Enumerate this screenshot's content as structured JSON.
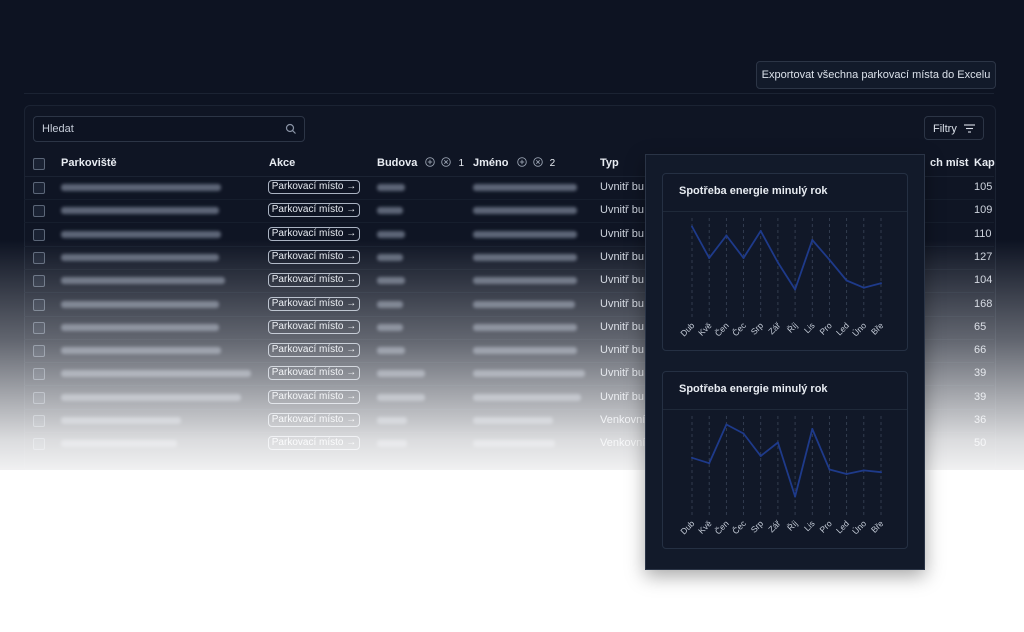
{
  "toolbar": {
    "export_label": "Exportovat všechna parkovací místa do Excelu"
  },
  "search": {
    "placeholder": "Hledat",
    "icon": "search-icon"
  },
  "filters": {
    "label": "Filtry",
    "icon": "filter-icon"
  },
  "table": {
    "columns": {
      "parkoviste": "Parkoviště",
      "akce": "Akce",
      "budova": "Budova",
      "budova_count": "1",
      "jmeno": "Jméno",
      "jmeno_count": "2",
      "typ": "Typ",
      "mist": "ch míst",
      "kap": "Kap"
    },
    "rows": [
      {
        "akce": "Parkovací místo →",
        "typ": "Uvnitř bu",
        "kap": "105",
        "w": [
          160,
          28,
          104
        ]
      },
      {
        "akce": "Parkovací místo →",
        "typ": "Uvnitř bu",
        "kap": "109",
        "w": [
          158,
          26,
          104
        ]
      },
      {
        "akce": "Parkovací místo →",
        "typ": "Uvnitř bu",
        "kap": "110",
        "w": [
          160,
          28,
          104
        ]
      },
      {
        "akce": "Parkovací místo →",
        "typ": "Uvnitř bu",
        "kap": "127",
        "w": [
          158,
          26,
          104
        ]
      },
      {
        "akce": "Parkovací místo →",
        "typ": "Uvnitř bu",
        "kap": "104",
        "w": [
          164,
          28,
          104
        ]
      },
      {
        "akce": "Parkovací místo →",
        "typ": "Uvnitř bu",
        "kap": "168",
        "w": [
          158,
          26,
          102
        ]
      },
      {
        "akce": "Parkovací místo →",
        "typ": "Uvnitř bu",
        "kap": "65",
        "w": [
          158,
          26,
          104
        ]
      },
      {
        "akce": "Parkovací místo →",
        "typ": "Uvnitř bu",
        "kap": "66",
        "w": [
          160,
          28,
          104
        ]
      },
      {
        "akce": "Parkovací místo →",
        "typ": "Uvnitř bu",
        "kap": "39",
        "w": [
          190,
          48,
          112
        ]
      },
      {
        "akce": "Parkovací místo →",
        "typ": "Uvnitř bu",
        "kap": "39",
        "w": [
          180,
          48,
          108
        ]
      },
      {
        "akce": "Parkovací místo →",
        "typ": "Venkovní",
        "kap": "36",
        "w": [
          120,
          30,
          80
        ]
      },
      {
        "akce": "Parkovací místo →",
        "typ": "Venkovní",
        "kap": "50",
        "w": [
          116,
          30,
          82
        ]
      }
    ]
  },
  "colors": {
    "background": "#0d1322",
    "line": "#1e3a8a",
    "accent": "#dbe1ea"
  },
  "chart_data": [
    {
      "type": "line",
      "title": "Spotřeba energie minulý rok",
      "categories": [
        "Dub",
        "Kvě",
        "Čen",
        "Čec",
        "Srp",
        "Zář",
        "Říj",
        "Lis",
        "Pro",
        "Led",
        "Úno",
        "Bře"
      ],
      "values": [
        95,
        60,
        85,
        60,
        90,
        55,
        25,
        80,
        58,
        35,
        27,
        32
      ],
      "ylim": [
        0,
        100
      ],
      "grid": "vertical-dashed"
    },
    {
      "type": "line",
      "title": "Spotřeba energie minulý rok",
      "categories": [
        "Dub",
        "Kvě",
        "Čen",
        "Čec",
        "Srp",
        "Zář",
        "Říj",
        "Lis",
        "Pro",
        "Led",
        "Úno",
        "Bře"
      ],
      "values": [
        58,
        52,
        95,
        85,
        60,
        75,
        15,
        90,
        45,
        40,
        44,
        42
      ],
      "ylim": [
        0,
        100
      ],
      "grid": "vertical-dashed"
    }
  ]
}
